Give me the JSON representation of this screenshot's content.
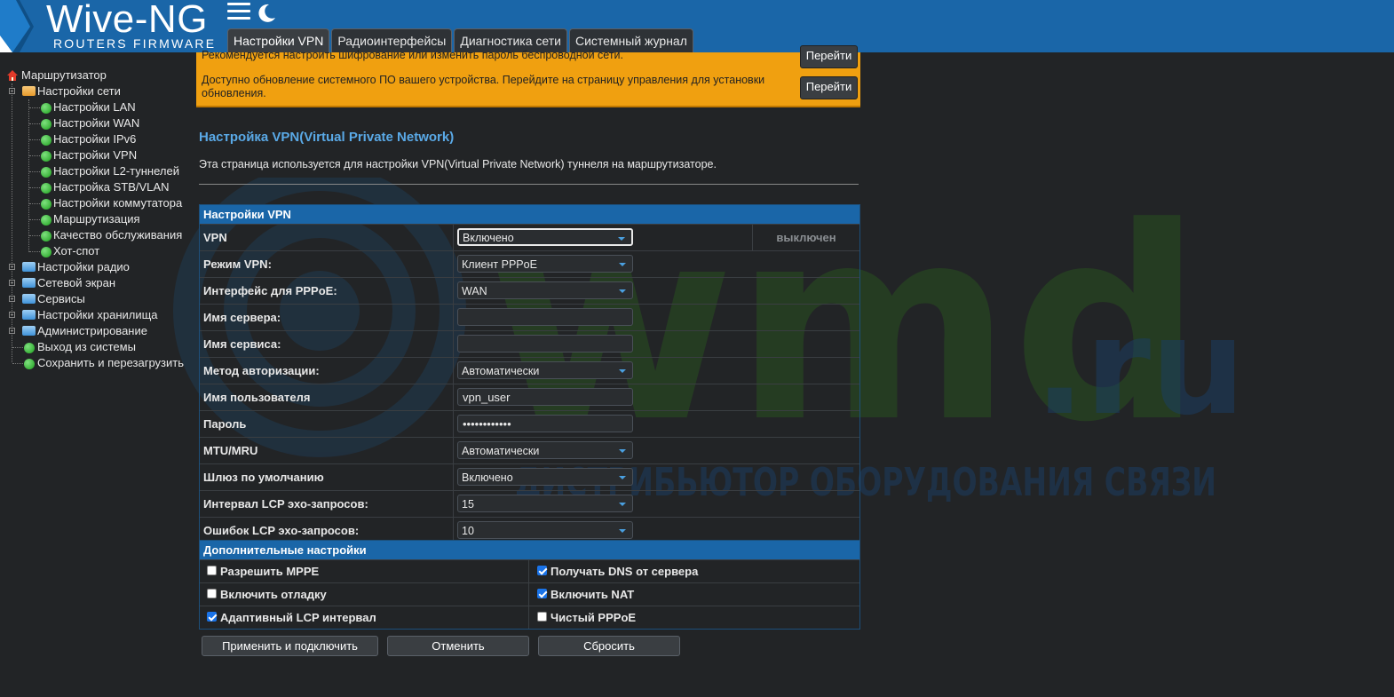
{
  "header": {
    "logo_title": "Wive-NG",
    "logo_subtitle": "ROUTERS FIRMWARE",
    "brand_color": "#1a66a8",
    "tabs": [
      {
        "label": "Настройки VPN",
        "active": true
      },
      {
        "label": "Радиоинтерфейсы",
        "active": false
      },
      {
        "label": "Диагностика сети",
        "active": false
      },
      {
        "label": "Системный журнал",
        "active": false
      }
    ]
  },
  "sidebar": {
    "root": "Маршрутизатор",
    "items": [
      {
        "label": "Настройки сети",
        "icon": "folder-open-icon"
      },
      {
        "label": "Настройки LAN",
        "icon": "green-dot-icon"
      },
      {
        "label": "Настройки WAN",
        "icon": "green-dot-icon"
      },
      {
        "label": "Настройки IPv6",
        "icon": "green-dot-icon"
      },
      {
        "label": "Настройки VPN",
        "icon": "green-dot-icon"
      },
      {
        "label": "Настройки L2-туннелей",
        "icon": "green-dot-icon"
      },
      {
        "label": "Настройка STB/VLAN",
        "icon": "green-dot-icon"
      },
      {
        "label": "Настройки коммутатора",
        "icon": "green-dot-icon"
      },
      {
        "label": "Маршрутизация",
        "icon": "green-dot-icon"
      },
      {
        "label": "Качество обслуживания",
        "icon": "green-dot-icon"
      },
      {
        "label": "Хот-спот",
        "icon": "green-dot-icon"
      },
      {
        "label": "Настройки радио",
        "icon": "folder-icon"
      },
      {
        "label": "Сетевой экран",
        "icon": "folder-icon"
      },
      {
        "label": "Сервисы",
        "icon": "folder-icon"
      },
      {
        "label": "Настройки хранилища",
        "icon": "folder-icon"
      },
      {
        "label": "Администрирование",
        "icon": "folder-icon"
      },
      {
        "label": "Выход из системы",
        "icon": "green-dot-icon"
      },
      {
        "label": "Сохранить и перезагрузить",
        "icon": "green-dot-icon"
      }
    ]
  },
  "banner": {
    "line1": "Рекомендуется настроить шифрование или изменить пароль беспроводной сети.",
    "line2": "Доступно обновление системного ПО вашего устройства. Перейдите на страницу управления для установки обновления.",
    "goto_label": "Перейти"
  },
  "page": {
    "title": "Настройка VPN(Virtual Private Network)",
    "description": "Эта страница используется для настройки VPN(Virtual Private Network) туннеля на маршрутизаторе."
  },
  "watermark": {
    "brand": "wmd",
    "tld": ".ru",
    "tagline": "ДИСТРИБЬЮТОР ОБОРУДОВАНИЯ СВЯЗИ"
  },
  "vpn_settings": {
    "header": "Настройки VPN",
    "vpn_label": "VPN",
    "vpn_value": "Включено",
    "vpn_status": "выключен",
    "mode_label": "Режим VPN:",
    "mode_value": "Клиент PPPoE",
    "iface_label": "Интерфейс для PPPoE:",
    "iface_value": "WAN",
    "server_label": "Имя сервера:",
    "server_value": "",
    "service_label": "Имя сервиса:",
    "service_value": "",
    "auth_label": "Метод авторизации:",
    "auth_value": "Автоматически",
    "user_label": "Имя пользователя",
    "user_value": "vpn_user",
    "pass_label": "Пароль",
    "pass_value": "••••••••••••",
    "mtu_label": "MTU/MRU",
    "mtu_value": "Автоматически",
    "gw_label": "Шлюз по умолчанию",
    "gw_value": "Включено",
    "lcp_int_label": "Интервал LCP эхо-запросов:",
    "lcp_int_value": "15",
    "lcp_err_label": "Ошибок LCP эхо-запросов:",
    "lcp_err_value": "10"
  },
  "extra": {
    "header": "Дополнительные настройки",
    "mppe": {
      "label": "Разрешить MPPE",
      "checked": false
    },
    "dns": {
      "label": "Получать DNS от сервера",
      "checked": true
    },
    "debug": {
      "label": "Включить отладку",
      "checked": false
    },
    "nat": {
      "label": "Включить NAT",
      "checked": true
    },
    "lcp_adaptive": {
      "label": "Адаптивный LCP интервал",
      "checked": true
    },
    "pure_pppoe": {
      "label": "Чистый PPPoE",
      "checked": false
    }
  },
  "buttons": {
    "apply": "Применить и подключить",
    "cancel": "Отменить",
    "reset": "Сбросить"
  }
}
